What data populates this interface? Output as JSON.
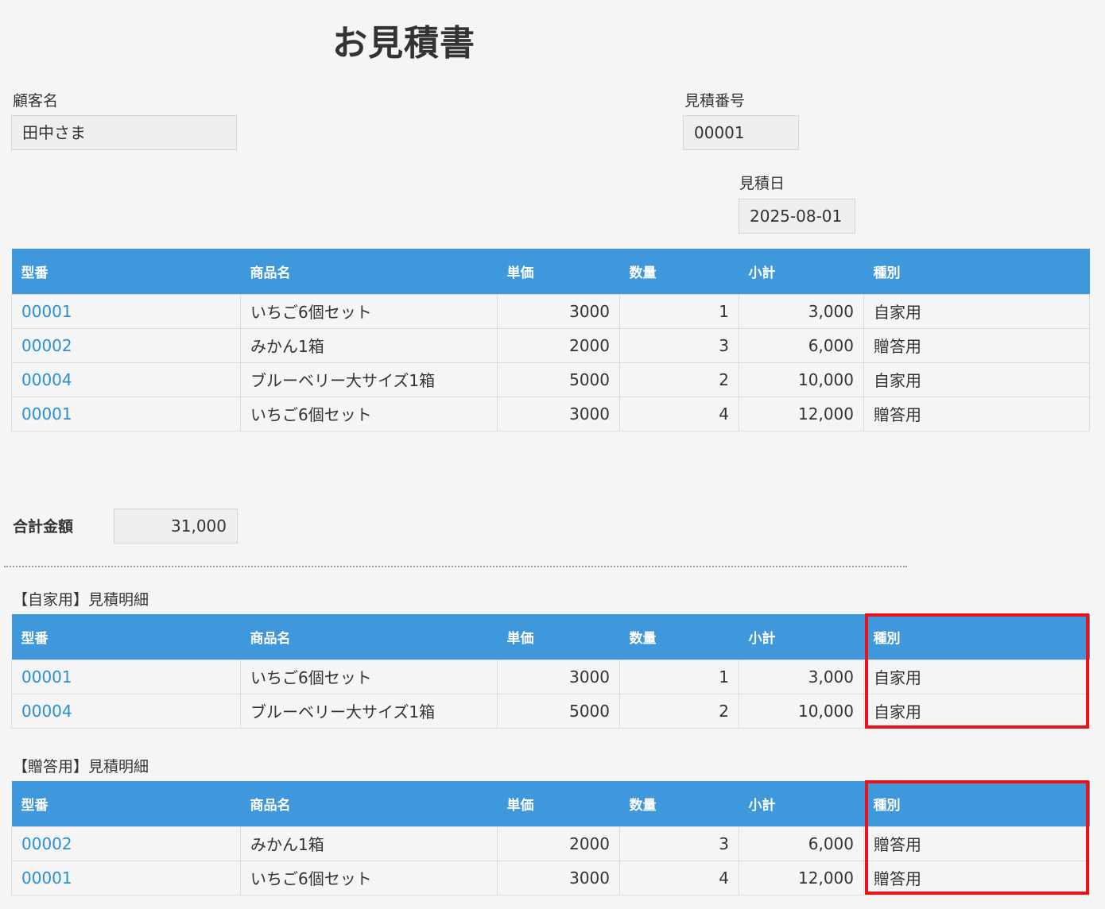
{
  "title": "お見積書",
  "customer": {
    "label": "顧客名",
    "value": "田中さま"
  },
  "estimate_no": {
    "label": "見積番号",
    "value": "00001"
  },
  "estimate_date": {
    "label": "見積日",
    "value": "2025-08-01"
  },
  "columns": [
    "型番",
    "商品名",
    "単価",
    "数量",
    "小計",
    "種別"
  ],
  "main_rows": [
    [
      "00001",
      "いちご6個セット",
      "3000",
      "1",
      "3,000",
      "自家用"
    ],
    [
      "00002",
      "みかん1箱",
      "2000",
      "3",
      "6,000",
      "贈答用"
    ],
    [
      "00004",
      "ブルーベリー大サイズ1箱",
      "5000",
      "2",
      "10,000",
      "自家用"
    ],
    [
      "00001",
      "いちご6個セット",
      "3000",
      "4",
      "12,000",
      "贈答用"
    ]
  ],
  "total": {
    "label": "合計金額",
    "value": "31,000"
  },
  "sections": [
    {
      "title": "【自家用】見積明細",
      "rows": [
        [
          "00001",
          "いちご6個セット",
          "3000",
          "1",
          "3,000",
          "自家用"
        ],
        [
          "00004",
          "ブルーベリー大サイズ1箱",
          "5000",
          "2",
          "10,000",
          "自家用"
        ]
      ]
    },
    {
      "title": "【贈答用】見積明細",
      "rows": [
        [
          "00002",
          "みかん1箱",
          "2000",
          "3",
          "6,000",
          "贈答用"
        ],
        [
          "00001",
          "いちご6個セット",
          "3000",
          "4",
          "12,000",
          "贈答用"
        ]
      ]
    }
  ],
  "colors": {
    "header_bg": "#3f98db",
    "link": "#2a8fd6",
    "highlight": "#e8131b"
  }
}
